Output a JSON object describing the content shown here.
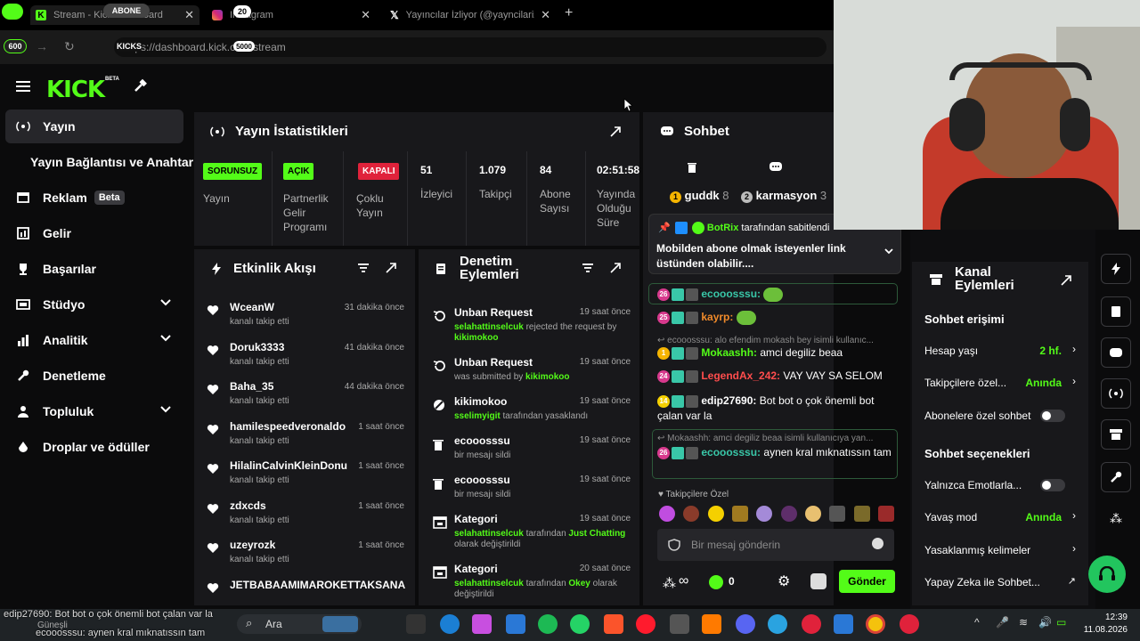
{
  "browser": {
    "tabs": [
      {
        "title": "Stream - Kick Dashboard",
        "overlay": "ABONE"
      },
      {
        "title": "Instagram",
        "badge": "20"
      },
      {
        "title": "Yayıncılar İzliyor (@yayncilarizlio"
      }
    ],
    "add_tab": "+",
    "url": "https://dashboard.kick.com/stream",
    "overlay_kicks": "KICKS",
    "overlay_600": "600",
    "overlay_5000": "5000"
  },
  "header": {
    "logo": "KICK",
    "beta": "BETA"
  },
  "sidebar": {
    "items": [
      {
        "label": "Yayın"
      },
      {
        "label": "Yayın Bağlantısı ve Anahtarı"
      },
      {
        "label": "Reklam",
        "badge": "Beta"
      },
      {
        "label": "Gelir"
      },
      {
        "label": "Başarılar"
      },
      {
        "label": "Stüdyo"
      },
      {
        "label": "Analitik"
      },
      {
        "label": "Denetleme"
      },
      {
        "label": "Topluluk"
      },
      {
        "label": "Droplar ve ödüller"
      }
    ]
  },
  "stats": {
    "title": "Yayın İstatistikleri",
    "cells": [
      {
        "badge": "SORUNSUZ",
        "badge_color": "#53fc18",
        "label": "Yayın"
      },
      {
        "badge": "AÇIK",
        "badge_color": "#53fc18",
        "label": "Partnerlik Gelir Programı"
      },
      {
        "badge": "KAPALI",
        "badge_color": "#e0223b",
        "label": "Çoklu Yayın"
      },
      {
        "value": "51",
        "label": "İzleyici"
      },
      {
        "value": "1.079",
        "label": "Takipçi"
      },
      {
        "value": "84",
        "label": "Abone Sayısı"
      },
      {
        "value": "02:51:58",
        "label": "Yayında Olduğu Süre"
      }
    ]
  },
  "activity": {
    "title": "Etkinlik Akışı",
    "items": [
      {
        "name": "WceanW",
        "action": "kanalı takip etti",
        "time": "31 dakika önce"
      },
      {
        "name": "Doruk3333",
        "action": "kanalı takip etti",
        "time": "41 dakika önce"
      },
      {
        "name": "Baha_35",
        "action": "kanalı takip etti",
        "time": "44 dakika önce"
      },
      {
        "name": "hamilespeedveronaldo",
        "action": "kanalı takip etti",
        "time": "1 saat önce"
      },
      {
        "name": "HilalinCalvinKleinDonu",
        "action": "kanalı takip etti",
        "time": "1 saat önce"
      },
      {
        "name": "zdxcds",
        "action": "kanalı takip etti",
        "time": "1 saat önce"
      },
      {
        "name": "uzeyrozk",
        "action": "kanalı takip etti",
        "time": "1 saat önce"
      },
      {
        "name": "JETBABAAMIMAROKETTAKSANA",
        "action": "",
        "time": ""
      }
    ]
  },
  "moderation": {
    "title_line1": "Denetim",
    "title_line2": "Eylemleri",
    "items": [
      {
        "title": "Unban Request",
        "time": "19 saat önce",
        "d1": "selahattinselcuk",
        "d2": " rejected the request by ",
        "d3": "kikimokoo"
      },
      {
        "title": "Unban Request",
        "time": "19 saat önce",
        "d1": "",
        "d2": "was submitted by ",
        "d3": "kikimokoo"
      },
      {
        "title": "kikimokoo",
        "time": "19 saat önce",
        "d1": "sselimyigit",
        "d2": " tarafından yasaklandı",
        "d3": ""
      },
      {
        "title": "ecooosssu",
        "time": "19 saat önce",
        "d1": "",
        "d2": "bir mesajı sildi",
        "d3": ""
      },
      {
        "title": "ecooosssu",
        "time": "19 saat önce",
        "d1": "",
        "d2": "bir mesajı sildi",
        "d3": ""
      },
      {
        "title": "Kategori",
        "time": "19 saat önce",
        "d1": "selahattinselcuk",
        "d2": " tarafından ",
        "d3": "Just Chatting",
        "d4": " olarak değiştirildi"
      },
      {
        "title": "Kategori",
        "time": "20 saat önce",
        "d1": "selahattinselcuk",
        "d2": " tarafından ",
        "d3": "Okey",
        "d4": " olarak değiştirildi"
      }
    ]
  },
  "chat": {
    "title": "Sohbet",
    "top_users": [
      {
        "rank": "1",
        "name": "guddk",
        "count": "8"
      },
      {
        "rank": "2",
        "name": "karmasyon",
        "count": "3"
      }
    ],
    "pinned": {
      "by": "BotRix",
      "suffix": "tarafından sabitlendi",
      "message": "Mobilden abone olmak isteyenler link üstünden olabilir...."
    },
    "messages": [
      {
        "lvl": "26",
        "user": "ecooosssu",
        "color": "#39c7a8",
        "text": ""
      },
      {
        "lvl": "25",
        "user": "kayrp",
        "color": "#f08a2a",
        "text": ""
      },
      {
        "reply": "ecooosssu: alo efendim mokash bey isimli kullanıc..."
      },
      {
        "lvl": "1",
        "user": "Mokaashh",
        "color": "#53fc18",
        "text": "amci degiliz beaa"
      },
      {
        "lvl": "24",
        "user": "LegendAx_242",
        "color": "#ff4d4d",
        "text": "VAY VAY SA SELOM"
      },
      {
        "lvl": "14",
        "user": "edip27690",
        "color": "#ffffff",
        "text": "Bot bot o çok önemli bot çalan var la"
      },
      {
        "reply": "Mokaashh: amci degiliz beaa isimli kullanıcıya yan..."
      },
      {
        "lvl": "26",
        "user": "ecooosssu",
        "color": "#39c7a8",
        "text": "aynen kral mıknatıssın tam"
      }
    ],
    "follower_only": "Takipçilere Özel",
    "input_placeholder": "Bir mesaj gönderin",
    "points": "0",
    "send": "Gönder"
  },
  "channel": {
    "title_line1": "Kanal",
    "title_line2": "Eylemleri",
    "sec1": "Sohbet erişimi",
    "rows1": [
      {
        "label": "Hesap yaşı",
        "value": "2 hf."
      },
      {
        "label": "Takipçilere özel...",
        "value": "Anında"
      },
      {
        "label": "Abonelere özel sohbet",
        "value": ""
      }
    ],
    "sec2": "Sohbet seçenekleri",
    "rows2": [
      {
        "label": "Yalnızca Emotlarla...",
        "value": ""
      },
      {
        "label": "Yavaş mod",
        "value": "Anında"
      },
      {
        "label": "Yasaklanmış kelimeler",
        "value": ""
      },
      {
        "label": "Yapay Zeka ile Sohbet...",
        "value": ""
      }
    ]
  },
  "taskbar": {
    "search": "Ara",
    "time": "12:39",
    "date": "11.08.2026"
  },
  "overlay_chat": {
    "line1": "edip27690: Bot bot o çok önemli bot çalan var la",
    "line1b": "Güneşli",
    "line2": "ecooosssu: aynen kral mıknatıssın tam"
  },
  "colors": {
    "accent": "#53fc18",
    "panel": "#18181b",
    "bg": "#0b0b0c"
  }
}
